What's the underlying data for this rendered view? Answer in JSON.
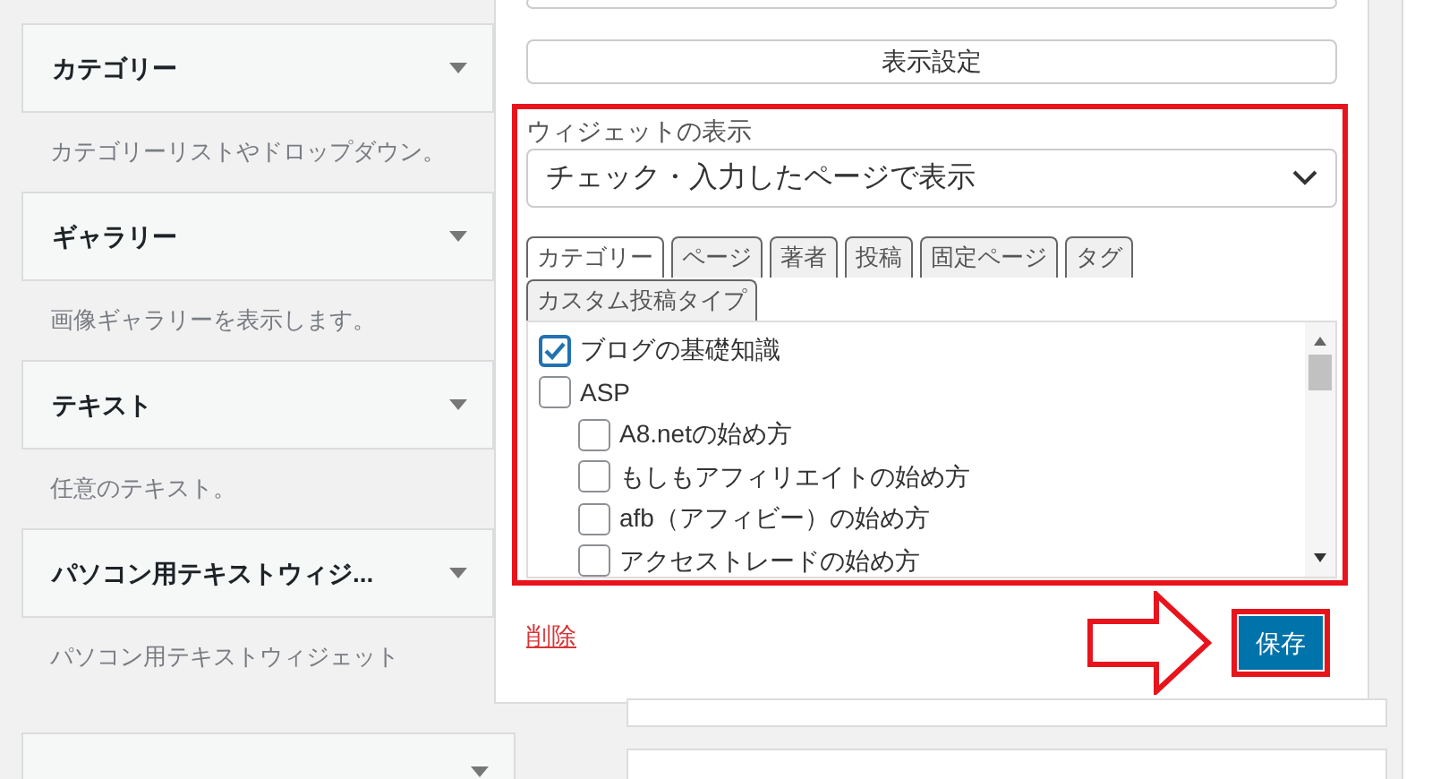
{
  "widgets": [
    {
      "title": "カテゴリー",
      "description": "カテゴリーリストやドロップダウン。"
    },
    {
      "title": "ギャラリー",
      "description": "画像ギャラリーを表示します。"
    },
    {
      "title": "テキスト",
      "description": "任意のテキスト。"
    },
    {
      "title": "パソコン用テキストウィジ...",
      "description": "パソコン用テキストウィジェット"
    },
    {
      "kind": "cut"
    }
  ],
  "panel": {
    "display_settings_button": "表示設定",
    "visibility": {
      "label": "ウィジェットの表示",
      "select_value": "チェック・入力したページで表示",
      "tabs": [
        {
          "label": "カテゴリー",
          "selected": true
        },
        {
          "label": "ページ",
          "selected": false
        },
        {
          "label": "著者",
          "selected": false
        },
        {
          "label": "投稿",
          "selected": false
        },
        {
          "label": "固定ページ",
          "selected": false
        },
        {
          "label": "タグ",
          "selected": false
        },
        {
          "label": "カスタム投稿タイプ",
          "selected": false
        }
      ],
      "categories": [
        {
          "label": "ブログの基礎知識",
          "checked": true
        },
        {
          "label": "ASP",
          "checked": false,
          "children": [
            {
              "label": "A8.netの始め方",
              "checked": false
            },
            {
              "label": "もしもアフィリエイトの始め方",
              "checked": false
            },
            {
              "label": "afb（アフィビー）の始め方",
              "checked": false
            },
            {
              "label": "アクセストレードの始め方",
              "checked": false
            }
          ]
        }
      ]
    },
    "delete_link": "削除",
    "save_button": "保存"
  }
}
